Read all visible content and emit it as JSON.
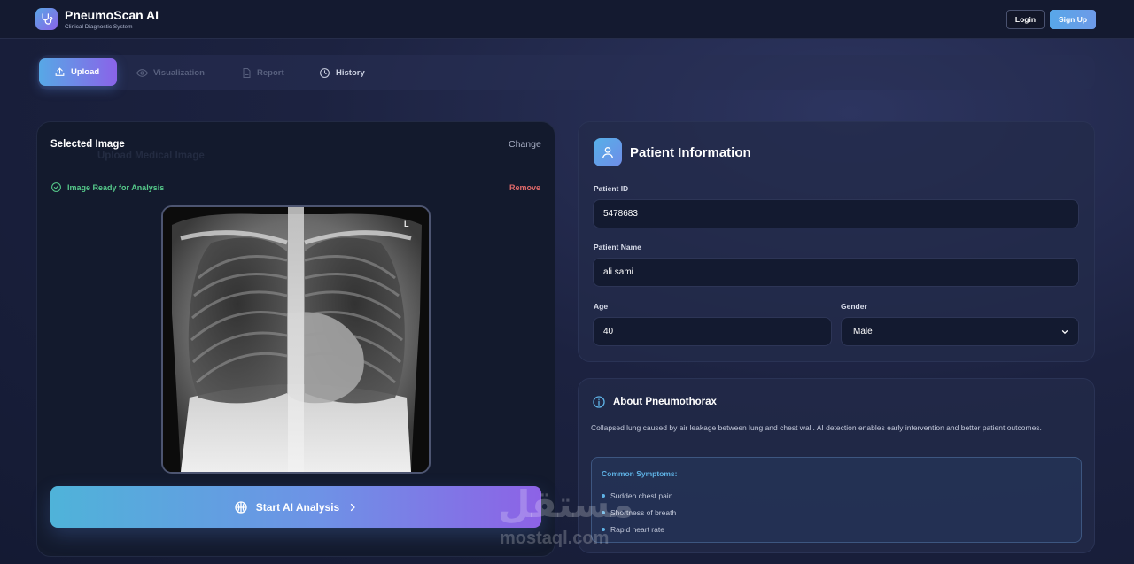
{
  "app": {
    "title": "PneumoScan AI",
    "subtitle": "Clinical Diagnostic System",
    "login_label": "Login",
    "signup_label": "Sign Up"
  },
  "tabs": [
    {
      "label": "Upload",
      "active": true
    },
    {
      "label": "Visualization",
      "active": false
    },
    {
      "label": "Report",
      "active": false
    },
    {
      "label": "History",
      "active": false
    }
  ],
  "upload": {
    "title": "Selected Image",
    "ghost_title": "Upload Medical Image",
    "change_label": "Change",
    "status": "Image Ready for Analysis",
    "remove_label": "Remove",
    "analyze_label": "Start AI Analysis"
  },
  "patient": {
    "title": "Patient Information",
    "id_label": "Patient ID",
    "id_value": "5478683",
    "name_label": "Patient Name",
    "name_value": "ali sami",
    "age_label": "Age",
    "age_value": "40",
    "gender_label": "Gender",
    "gender_value": "Male"
  },
  "about": {
    "title": "About Pneumothorax",
    "description": "Collapsed lung caused by air leakage between lung and chest wall. AI detection enables early intervention and better patient outcomes.",
    "symptoms_title": "Common Symptoms:",
    "symptoms": [
      "Sudden chest pain",
      "Shortness of breath",
      "Rapid heart rate"
    ]
  },
  "watermark": {
    "arabic": "مستقل",
    "latin": "mostaql.com"
  },
  "colors": {
    "accent_start": "#57a8e6",
    "accent_end": "#8a63e8",
    "success": "#55c98a",
    "danger": "#e06a6a",
    "info": "#5fb3e6"
  },
  "icons": [
    "stethoscope-icon",
    "upload-icon",
    "eye-icon",
    "document-icon",
    "clock-icon",
    "check-circle-icon",
    "brain-icon",
    "chevron-right-icon",
    "user-icon",
    "info-icon",
    "chevron-down-icon"
  ]
}
